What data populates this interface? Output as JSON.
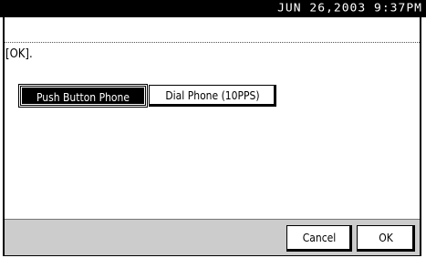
{
  "header": {
    "datetime": "JUN  26,2003  9:37PM"
  },
  "dialog": {
    "message": "[OK].",
    "options": [
      {
        "label": "Push Button Phone",
        "selected": true
      },
      {
        "label": "Dial Phone (10PPS)",
        "selected": false
      }
    ]
  },
  "footer": {
    "cancel_label": "Cancel",
    "ok_label": "OK"
  },
  "colors": {
    "header_bg": "#000000",
    "header_text": "#ffffff",
    "selected_bg": "#000000",
    "selected_text": "#ffffff",
    "footer_pattern": "#dcdcdc"
  }
}
